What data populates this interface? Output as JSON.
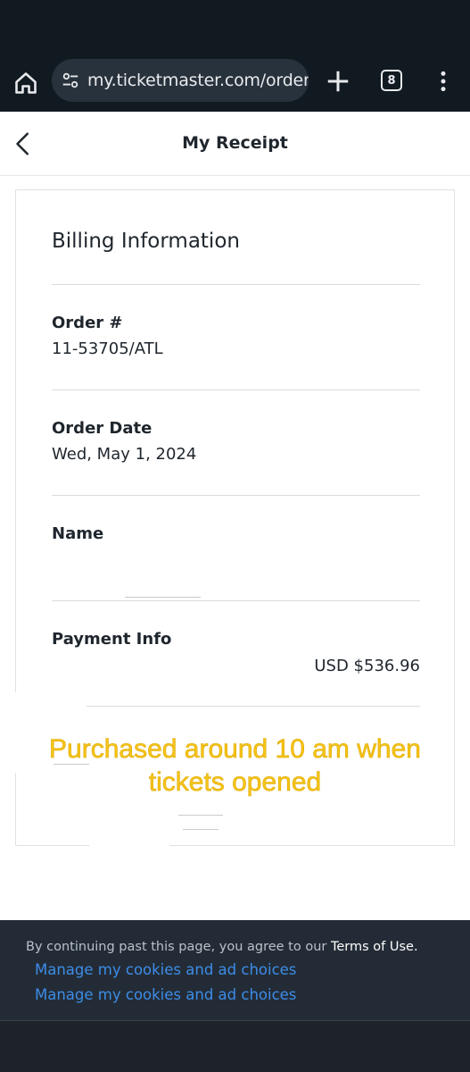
{
  "browser": {
    "url": "my.ticketmaster.com/order/",
    "tab_count": "8",
    "icons": {
      "home": "home-icon",
      "site_settings": "tune-icon",
      "new_tab": "plus-icon",
      "menu": "more-vert-icon"
    }
  },
  "header": {
    "title": "My Receipt",
    "back_icon": "chevron-left-icon"
  },
  "receipt": {
    "heading": "Billing Information",
    "order_number": {
      "label": "Order #",
      "value": "11-53705/ATL"
    },
    "order_date": {
      "label": "Order Date",
      "value": "Wed, May 1, 2024"
    },
    "name": {
      "label": "Name",
      "value": ""
    },
    "payment": {
      "label": "Payment Info",
      "value": "",
      "amount": "USD $536.96"
    }
  },
  "annotation": {
    "text": "Purchased around 10 am when tickets opened",
    "color": "#f5c518"
  },
  "cookie_banner": {
    "notice_prefix": "By continuing past this page, you agree to our ",
    "terms_link": "Terms of Use.",
    "manage_link_1": "Manage my cookies and ad choices",
    "manage_link_2": "Manage my cookies and ad choices"
  },
  "colors": {
    "chrome_bg": "#121a21",
    "banner_bg": "#232c36",
    "link_blue": "#3d8ce8",
    "text_dark": "#1f262d"
  }
}
